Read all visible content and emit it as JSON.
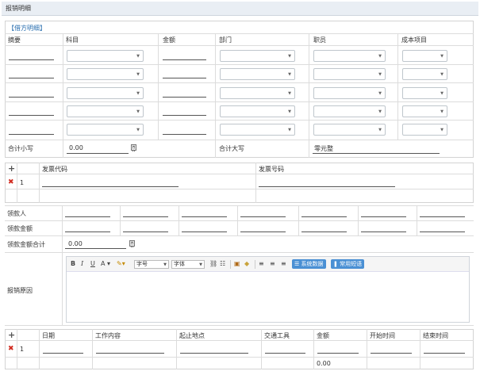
{
  "header": {
    "title": "报销明细"
  },
  "debit": {
    "section_label": "【借方明细】",
    "columns": [
      "摘要",
      "科目",
      "金额",
      "部门",
      "职员",
      "成本项目"
    ],
    "subtotal_label": "合计小写",
    "subtotal_value": "0.00",
    "uppercase_label": "合计大写",
    "uppercase_value": "零元整"
  },
  "invoice": {
    "columns": [
      "发票代码",
      "发票号码"
    ],
    "row_number": "1"
  },
  "payee": {
    "payee_label": "领款人",
    "amount_label": "领款金额",
    "total_label": "领款金额合计",
    "total_value": "0.00"
  },
  "reason": {
    "label": "报销原因",
    "toolbar": {
      "font_size_placeholder": "字号",
      "font_family_placeholder": "字体",
      "system_data_button": "系统数据",
      "common_phrase_button": "常用短语"
    }
  },
  "trip": {
    "columns": [
      "日期",
      "工作内容",
      "起止地点",
      "交通工具",
      "金额",
      "开始时间",
      "结束时间"
    ],
    "row_number": "1",
    "total_amount": "0.00"
  },
  "colors": {
    "header_bg": "#e9eef4",
    "link": "#2a6fb0",
    "delete": "#d12b1f",
    "button": "#4a90d4"
  }
}
